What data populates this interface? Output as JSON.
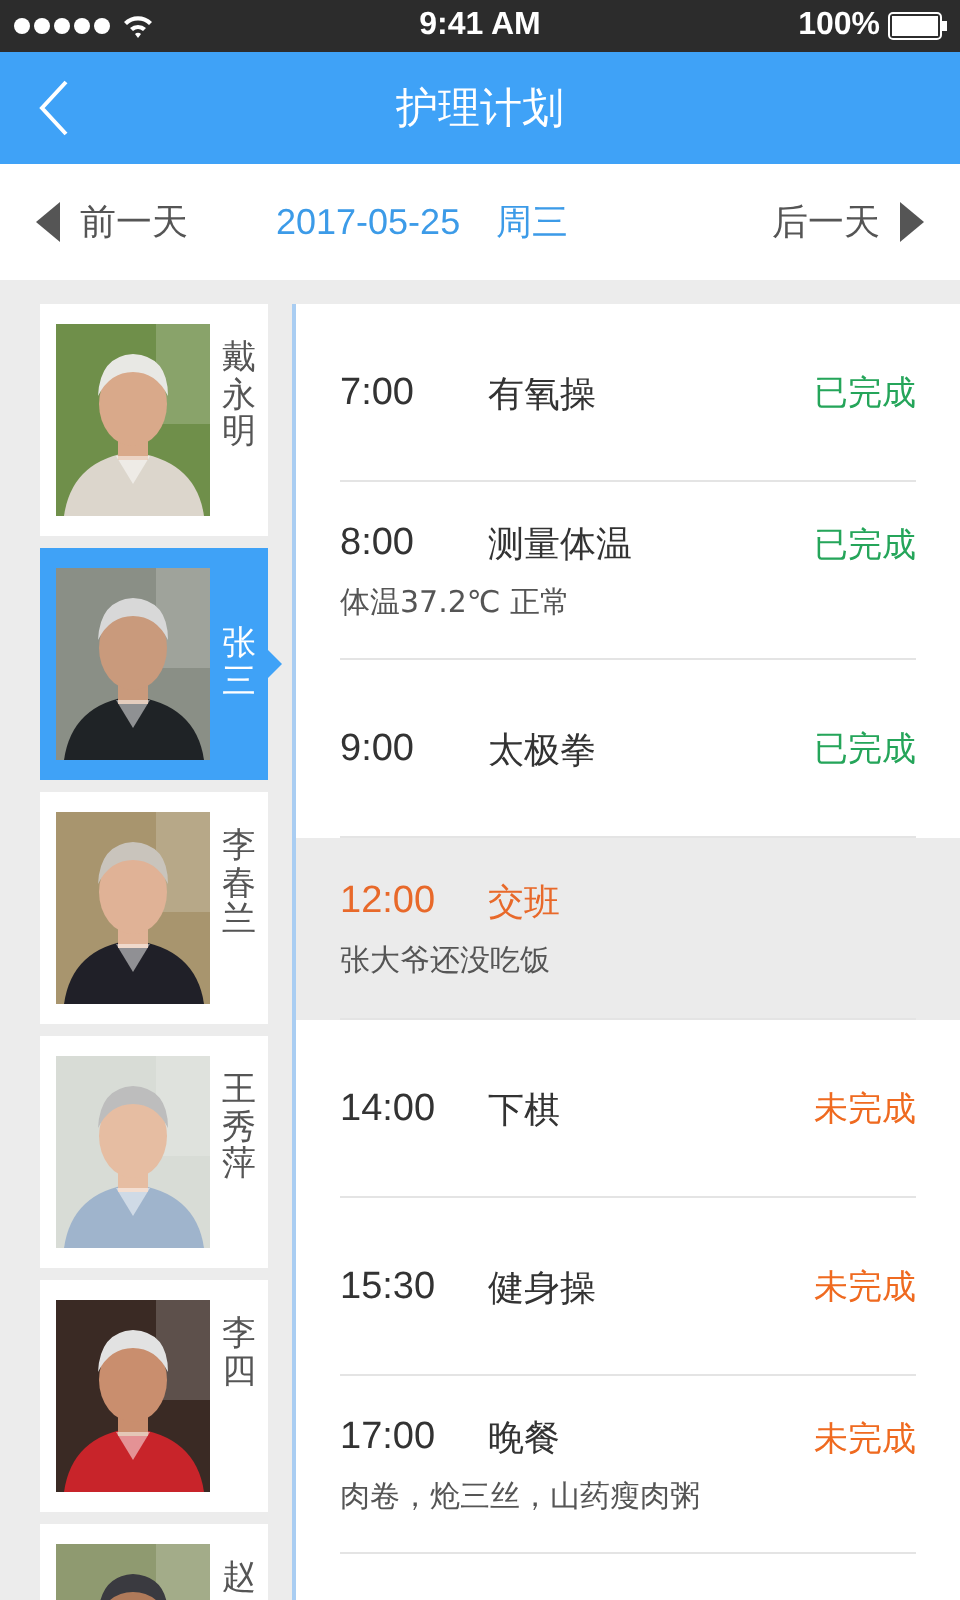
{
  "status_bar": {
    "time": "9:41 AM",
    "battery": "100%"
  },
  "header": {
    "title": "护理计划"
  },
  "date_bar": {
    "prev": "前一天",
    "date": "2017-05-25",
    "weekday": "周三",
    "next": "后一天"
  },
  "residents": [
    {
      "name": "戴永明",
      "selected": false
    },
    {
      "name": "张三",
      "selected": true
    },
    {
      "name": "李春兰",
      "selected": false
    },
    {
      "name": "王秀萍",
      "selected": false
    },
    {
      "name": "李四",
      "selected": false
    },
    {
      "name": "赵",
      "selected": false
    }
  ],
  "tasks": [
    {
      "kind": "task",
      "time": "7:00",
      "title": "有氧操",
      "status": "已完成",
      "done": true
    },
    {
      "kind": "task",
      "time": "8:00",
      "title": "测量体温",
      "status": "已完成",
      "done": true,
      "note": "体温37.2℃ 正常"
    },
    {
      "kind": "task",
      "time": "9:00",
      "title": "太极拳",
      "status": "已完成",
      "done": true
    },
    {
      "kind": "handover",
      "time": "12:00",
      "title": "交班",
      "note": "张大爷还没吃饭"
    },
    {
      "kind": "task",
      "time": "14:00",
      "title": "下棋",
      "status": "未完成",
      "done": false
    },
    {
      "kind": "task",
      "time": "15:30",
      "title": "健身操",
      "status": "未完成",
      "done": false
    },
    {
      "kind": "task",
      "time": "17:00",
      "title": "晚餐",
      "status": "未完成",
      "done": false,
      "note": "肉卷，炝三丝，山药瘦肉粥"
    }
  ]
}
